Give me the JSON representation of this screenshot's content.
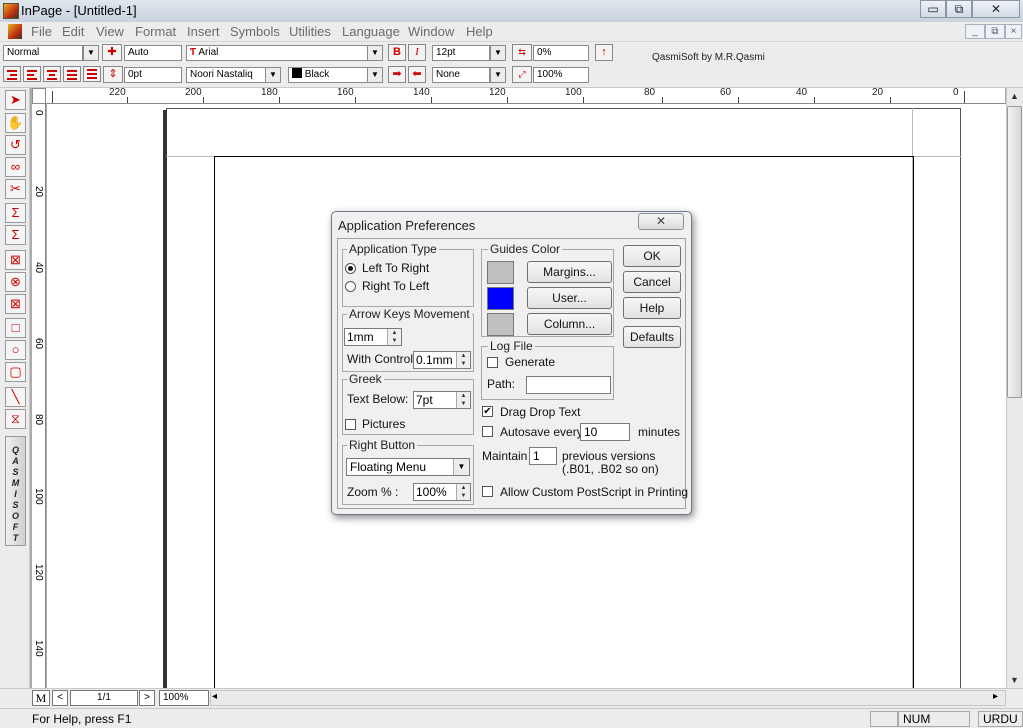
{
  "window": {
    "title": "InPage - [Untitled-1]",
    "min": "▭",
    "restore": "⧉",
    "close": "✕"
  },
  "menu": {
    "items": [
      "File",
      "Edit",
      "View",
      "Format",
      "Insert",
      "Symbols",
      "Utilities",
      "Language",
      "Window",
      "Help"
    ]
  },
  "mdi": {
    "min": "_",
    "restore": "⧉",
    "close": "×"
  },
  "toolbar": {
    "style": "Normal",
    "leading": "Auto",
    "font": "Arial",
    "bold": "B",
    "italic": "I",
    "size": "12pt",
    "tracking": "0%",
    "indent": "0pt",
    "urdu_font": "Noori Nastaliq",
    "color": "Black",
    "shade": "None",
    "scale": "100%",
    "credit": "QasmiSoft by M.R.Qasmi"
  },
  "ruler": {
    "h": [
      "220",
      "200",
      "180",
      "160",
      "140",
      "120",
      "100",
      "80",
      "60",
      "40",
      "20",
      "0"
    ],
    "v": [
      "0",
      "20",
      "40",
      "60",
      "80",
      "100",
      "120",
      "140"
    ]
  },
  "tools": {
    "qasmi": "QASMI SOFT"
  },
  "bottom": {
    "master": "M",
    "prev": "<",
    "page": "1/1",
    "next": ">",
    "zoom": "100%",
    "scroll_left": "◂",
    "scroll_right": "▸"
  },
  "status": {
    "help": "For Help, press F1",
    "num": "NUM",
    "lang": "URDU"
  },
  "dialog": {
    "title": "Application Preferences",
    "close": "✕",
    "app_type": {
      "title": "Application Type",
      "ltr": "Left To Right",
      "rtl": "Right To Left",
      "selected": "ltr"
    },
    "arrow": {
      "title": "Arrow Keys Movement",
      "value": "1mm",
      "with_control_label": "With Control:",
      "with_control_value": "0.1mm"
    },
    "greek": {
      "title": "Greek",
      "text_below_label": "Text Below:",
      "text_below_value": "7pt",
      "pictures_label": "Pictures",
      "pictures_checked": false
    },
    "right_button": {
      "title": "Right Button",
      "value": "Floating Menu",
      "zoom_label": "Zoom % :",
      "zoom_value": "100%"
    },
    "guides": {
      "title": "Guides Color",
      "margins": "Margins...",
      "user": "User...",
      "column": "Column...",
      "margins_color": "#c0c0c0",
      "user_color": "#0000ff",
      "column_color": "#c0c0c0"
    },
    "log": {
      "title": "Log File",
      "generate_label": "Generate",
      "path_label": "Path:",
      "path_value": ""
    },
    "drag_drop": {
      "label": "Drag Drop Text",
      "checked": true
    },
    "autosave": {
      "label": "Autosave every:",
      "value": "10",
      "unit": "minutes",
      "checked": false
    },
    "maintain": {
      "label": "Maintain",
      "value": "1",
      "text1": "previous versions",
      "text2": "(.B01, .B02 so on)"
    },
    "postscript": {
      "label": "Allow Custom PostScript in Printing",
      "checked": false
    },
    "buttons": {
      "ok": "OK",
      "cancel": "Cancel",
      "help": "Help",
      "defaults": "Defaults"
    }
  }
}
